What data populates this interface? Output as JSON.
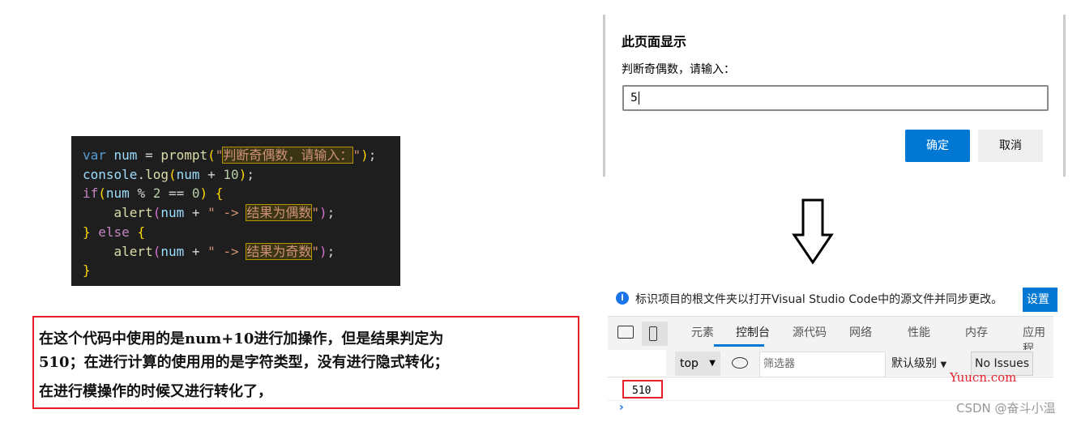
{
  "code": {
    "lines": [
      [
        [
          "var",
          "kw"
        ],
        [
          " num ",
          "id"
        ],
        [
          "= ",
          "op"
        ],
        [
          "prompt",
          "fn"
        ],
        [
          "(",
          "br1"
        ],
        [
          "\"",
          "st"
        ],
        [
          "判断奇偶数，请输入：",
          "st hl"
        ],
        [
          "\"",
          "st"
        ],
        [
          ")",
          "br1"
        ],
        [
          ";",
          "op"
        ]
      ],
      [
        [
          "console",
          "id"
        ],
        [
          ".",
          "op"
        ],
        [
          "log",
          "fn"
        ],
        [
          "(",
          "br1"
        ],
        [
          "num ",
          "id"
        ],
        [
          "+ ",
          "op"
        ],
        [
          "10",
          "nu"
        ],
        [
          ")",
          "br1"
        ],
        [
          ";",
          "op"
        ]
      ],
      [
        [
          "if",
          "ctl"
        ],
        [
          "(",
          "br1"
        ],
        [
          "num ",
          "id"
        ],
        [
          "% ",
          "op"
        ],
        [
          "2 ",
          "nu"
        ],
        [
          "== ",
          "op"
        ],
        [
          "0",
          "nu"
        ],
        [
          ") ",
          "br1"
        ],
        [
          "{",
          "br1"
        ]
      ],
      [
        [
          "    alert",
          "fn"
        ],
        [
          "(",
          "br2"
        ],
        [
          "num ",
          "id"
        ],
        [
          "+ ",
          "op"
        ],
        [
          "\" -> ",
          "st"
        ],
        [
          "结果为偶数",
          "st hl"
        ],
        [
          "\"",
          "st"
        ],
        [
          ")",
          "br2"
        ],
        [
          ";",
          "op"
        ]
      ],
      [
        [
          "} ",
          "br1"
        ],
        [
          "else ",
          "ctl"
        ],
        [
          "{",
          "br1"
        ]
      ],
      [
        [
          "    alert",
          "fn"
        ],
        [
          "(",
          "br2"
        ],
        [
          "num ",
          "id"
        ],
        [
          "+ ",
          "op"
        ],
        [
          "\" -> ",
          "st"
        ],
        [
          "结果为奇数",
          "st hl"
        ],
        [
          "\"",
          "st"
        ],
        [
          ")",
          "br2"
        ],
        [
          ";",
          "op"
        ]
      ],
      [
        [
          "}",
          "br1"
        ]
      ]
    ]
  },
  "note": {
    "lines": [
      "在这个代码中使用的是num+10进行加操作，但是结果判定为",
      "510；在进行计算的使用用的是字符类型，没有进行隐式转化；",
      " 在进行模操作的时候又进行转化了，"
    ]
  },
  "dialog": {
    "title": "此页面显示",
    "message": "判断奇偶数，请输入：",
    "input_value": "5",
    "ok": "确定",
    "cancel": "取消",
    "accent": "#0078d4"
  },
  "devtools": {
    "info": "标识项目的根文件夹以打开Visual Studio Code中的源文件并同步更改。",
    "info_button": "设置",
    "tabs": [
      "元素",
      "控制台",
      "源代码",
      "网络",
      "性能",
      "内存",
      "应用程"
    ],
    "active_tab": 1,
    "context": "top",
    "filter_placeholder": "筛选器",
    "level": "默认级别",
    "issues": "No Issues",
    "output": "510"
  },
  "watermark1": "Yuucn.com",
  "watermark2": "CSDN @奋斗小温"
}
